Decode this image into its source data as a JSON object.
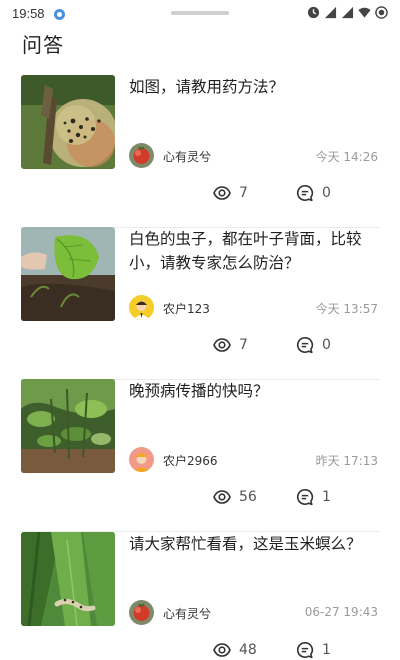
{
  "status_bar": {
    "time": "19:58"
  },
  "page": {
    "title": "问答"
  },
  "questions": [
    {
      "title": "如图，请教用药方法？",
      "author": "心有灵兮",
      "time": "今天 14:26",
      "views": "7",
      "comments": "0"
    },
    {
      "title": "白色的虫子，都在叶子背面，比较小，请教专家怎么防治？",
      "author": "农户123",
      "time": "今天 13:57",
      "views": "7",
      "comments": "0"
    },
    {
      "title": "晚预病传播的快吗？",
      "author": "农户2966",
      "time": "昨天 17:13",
      "views": "56",
      "comments": "1"
    },
    {
      "title": "请大家帮忙看看，这是玉米螟么？",
      "author": "心有灵兮",
      "time": "06-27 19:43",
      "views": "48",
      "comments": "1"
    }
  ]
}
